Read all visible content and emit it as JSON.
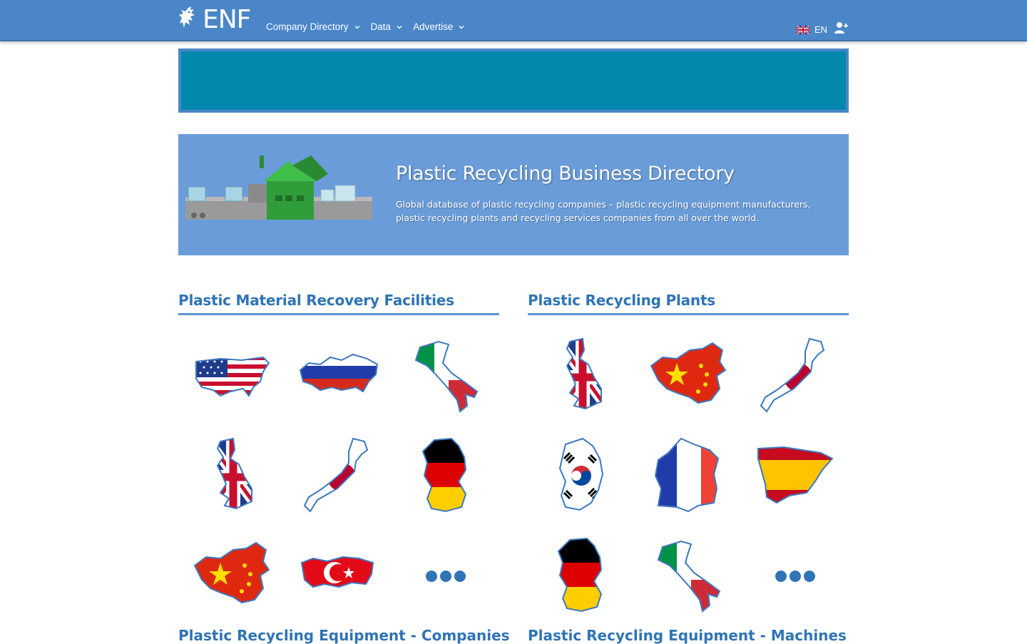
{
  "header": {
    "logo_text": "ENF",
    "nav": [
      {
        "label": "Company Directory"
      },
      {
        "label": "Data"
      },
      {
        "label": "Advertise"
      }
    ],
    "language": "EN"
  },
  "hero": {
    "title": "Plastic Recycling Business Directory",
    "description": "Global database of plastic recycling companies – plastic recycling equipment manufacturers, plastic recycling plants and recycling services companies from all over the world."
  },
  "sections": [
    {
      "title": "Plastic Material Recovery Facilities",
      "countries": [
        "United States",
        "Russia",
        "Italy",
        "United Kingdom",
        "Japan",
        "Germany",
        "China",
        "Turkey",
        "more"
      ]
    },
    {
      "title": "Plastic Recycling Plants",
      "countries": [
        "United Kingdom",
        "China",
        "Japan",
        "South Korea",
        "France",
        "Spain",
        "Germany",
        "Italy",
        "more"
      ]
    }
  ],
  "next_sections": [
    {
      "title": "Plastic Recycling Equipment - Companies"
    },
    {
      "title": "Plastic Recycling Equipment - Machines"
    }
  ],
  "colors": {
    "topbar": "#4a86c8",
    "ad_banner": "#0088ad",
    "hero_bg": "#6a9cd9",
    "section_title": "#2f74b5",
    "more_dots": "#2f74b5"
  }
}
